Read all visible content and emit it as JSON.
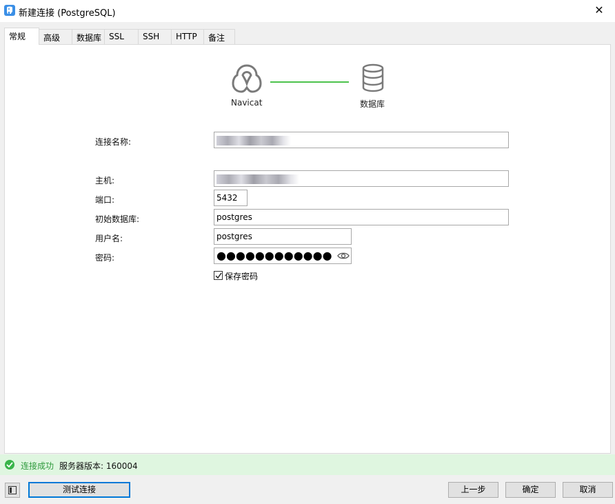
{
  "window": {
    "title": "新建连接 (PostgreSQL)",
    "close_glyph": "✕",
    "app_icon": "postgresql-elephant-icon"
  },
  "tabs": [
    {
      "label": "常规",
      "active": true
    },
    {
      "label": "高级",
      "active": false
    },
    {
      "label": "数据库",
      "active": false
    },
    {
      "label": "SSL",
      "active": false
    },
    {
      "label": "SSH",
      "active": false
    },
    {
      "label": "HTTP",
      "active": false
    },
    {
      "label": "备注",
      "active": false
    }
  ],
  "diagram": {
    "source_label": "Navicat",
    "target_label": "数据库",
    "source_icon": "navicat-icon",
    "target_icon": "database-icon",
    "line_color": "#4cc24c"
  },
  "form": {
    "connection_name": {
      "label": "连接名称:",
      "value": ""
    },
    "host": {
      "label": "主机:",
      "value": ""
    },
    "port": {
      "label": "端口:",
      "value": "5432"
    },
    "initial_database": {
      "label": "初始数据库:",
      "value": "postgres"
    },
    "username": {
      "label": "用户名:",
      "value": "postgres"
    },
    "password": {
      "label": "密码:",
      "masked": "●●●●●●●●●●●●",
      "reveal_icon": "eye-icon"
    },
    "save_password": {
      "label": "保存密码",
      "checked": true
    }
  },
  "status": {
    "success_text": "连接成功",
    "server_version": "服务器版本: 160004",
    "color": "#39b54a"
  },
  "buttons": {
    "test_connection": "测试连接",
    "previous": "上一步",
    "ok": "确定",
    "cancel": "取消"
  }
}
